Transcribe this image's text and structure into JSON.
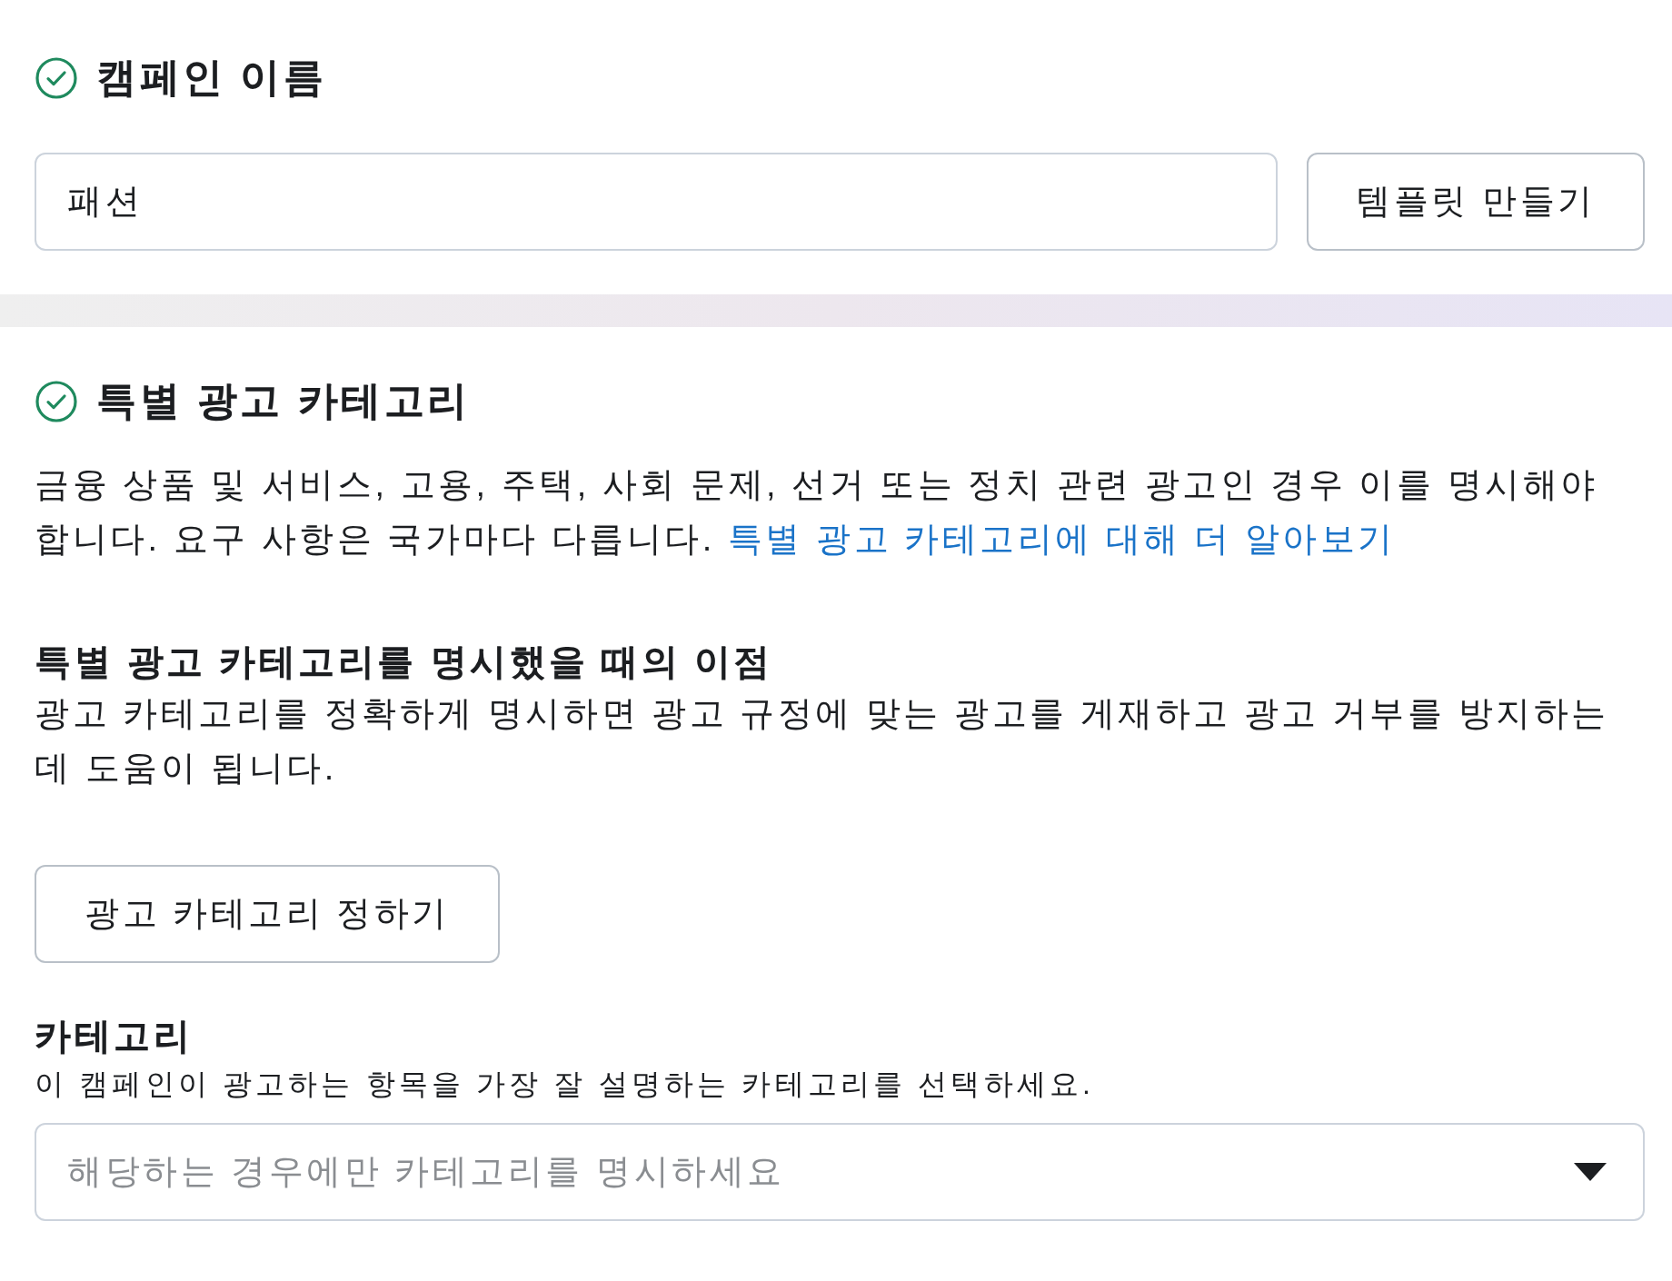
{
  "campaign_name": {
    "title": "캠페인 이름",
    "complete": true,
    "name_field": {
      "value": "패션"
    },
    "template_button": "템플릿 만들기"
  },
  "special_ad_category": {
    "title": "특별 광고 카테고리",
    "complete": true,
    "description": "금융 상품 및 서비스, 고용, 주택, 사회 문제, 선거 또는 정치 관련 광고인 경우 이를 명시해야 합니다. 요구 사항은 국가마다 다릅니다.",
    "learn_more_link": "특별 광고 카테고리에 대해 더 알아보기",
    "benefits": {
      "title": "특별 광고 카테고리를 명시했을 때의 이점",
      "text": "광고 카테고리를 정확하게 명시하면 광고 규정에 맞는 광고를 게재하고 광고 거부를 방지하는 데 도움이 됩니다."
    },
    "define_button": "광고 카테고리 정하기",
    "category": {
      "label": "카테고리",
      "hint": "이 캠페인이 광고하는 항목을 가장 잘 설명하는 카테고리를 선택하세요.",
      "dropdown": {
        "placeholder": "해당하는 경우에만 카테고리를 명시하세요"
      }
    }
  }
}
